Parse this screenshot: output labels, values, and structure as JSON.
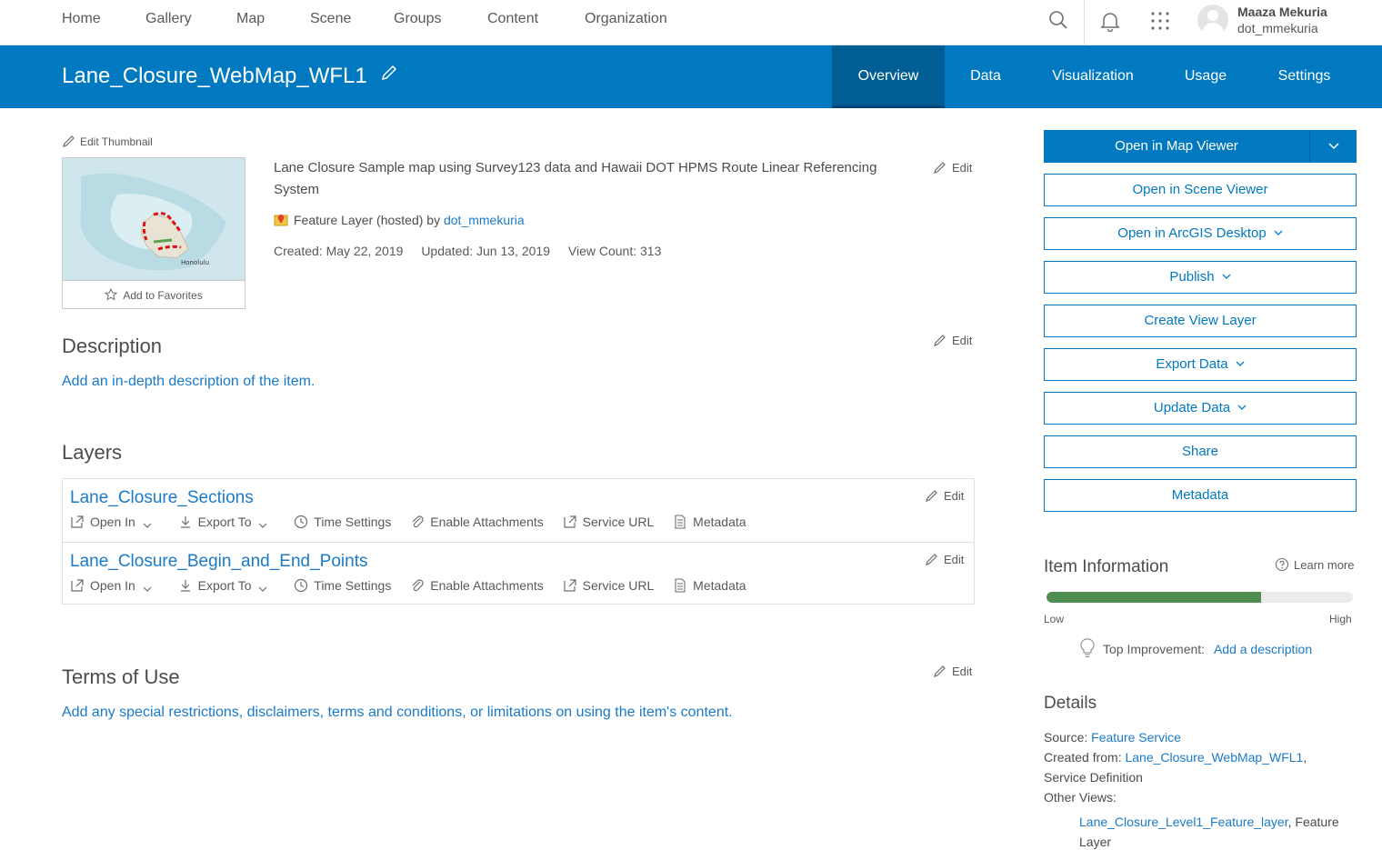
{
  "nav": {
    "items": [
      "Home",
      "Gallery",
      "Map",
      "Scene",
      "Groups",
      "Content",
      "Organization"
    ],
    "user_name": "Maaza Mekuria",
    "user_id": "dot_mmekuria"
  },
  "header": {
    "title": "Lane_Closure_WebMap_WFL1",
    "tabs": [
      "Overview",
      "Data",
      "Visualization",
      "Usage",
      "Settings"
    ],
    "active_tab": "Overview"
  },
  "item": {
    "edit_thumbnail": "Edit Thumbnail",
    "add_favorites": "Add to Favorites",
    "thumb_label": "Honolulu",
    "summary": "Lane Closure Sample map using Survey123 data and Hawaii DOT HPMS Route Linear Referencing System",
    "type_prefix": "Feature Layer (hosted) by",
    "owner": "dot_mmekuria",
    "created": "Created: May 22, 2019",
    "updated": "Updated: Jun 13, 2019",
    "view_count": "View Count: 313",
    "edit_label": "Edit"
  },
  "description": {
    "heading": "Description",
    "link": "Add an in-depth description of the item."
  },
  "layers": {
    "heading": "Layers",
    "rows": [
      {
        "title": "Lane_Closure_Sections"
      },
      {
        "title": "Lane_Closure_Begin_and_End_Points"
      }
    ],
    "actions": {
      "open_in": "Open In",
      "export_to": "Export To",
      "time_settings": "Time Settings",
      "enable_attachments": "Enable Attachments",
      "service_url": "Service URL",
      "metadata": "Metadata"
    }
  },
  "terms": {
    "heading": "Terms of Use",
    "link": "Add any special restrictions, disclaimers, terms and conditions, or limitations on using the item's content."
  },
  "actions": {
    "open_map_viewer": "Open in Map Viewer",
    "open_scene_viewer": "Open in Scene Viewer",
    "open_arcgis_desktop": "Open in ArcGIS Desktop",
    "publish": "Publish",
    "create_view_layer": "Create View Layer",
    "export_data": "Export Data",
    "update_data": "Update Data",
    "share": "Share",
    "metadata": "Metadata"
  },
  "item_info": {
    "heading": "Item Information",
    "learn_more": "Learn more",
    "low": "Low",
    "high": "High",
    "score_fraction": 0.7,
    "top_improvement_label": "Top Improvement:",
    "top_improvement_link": "Add a description"
  },
  "details": {
    "heading": "Details",
    "source_label": "Source:",
    "source_value": "Feature Service",
    "created_from_label": "Created from:",
    "created_from_value": "Lane_Closure_WebMap_WFL1",
    "created_from_suffix": "Service Definition",
    "other_views_label": "Other Views:",
    "other_view_link": "Lane_Closure_Level1_Feature_layer",
    "other_view_suffix": ", Feature Layer"
  },
  "colors": {
    "brand_blue": "#0079c1",
    "active_tab": "#005e95",
    "link": "#1b7ac7",
    "meter_fill": "#4f8c4f"
  }
}
